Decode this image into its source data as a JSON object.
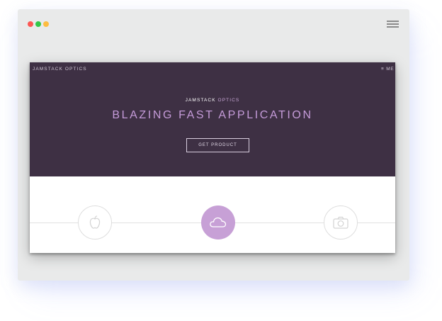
{
  "window": {
    "controls": [
      {
        "name": "close",
        "color": "#fc5753"
      },
      {
        "name": "minimize",
        "color": "#fdbc40"
      },
      {
        "name": "maximize",
        "color": "#33c748"
      }
    ],
    "menu_icon": "hamburger-icon"
  },
  "site": {
    "brand": "JAMSTACK OPTICS",
    "menu_label": "≡ ME"
  },
  "hero": {
    "kicker_main": "JAMSTACK",
    "kicker_sub": "OPTICS",
    "title": "BLAZING FAST APPLICATION",
    "cta_label": "GET PRODUCT"
  },
  "features": [
    {
      "icon": "apple-icon",
      "state": "outline"
    },
    {
      "icon": "cloud-icon",
      "state": "active"
    },
    {
      "icon": "camera-icon",
      "state": "outline"
    }
  ],
  "colors": {
    "hero_bg": "#3e3044",
    "accent": "#c59bd9",
    "active_circle": "#c7a0d6"
  }
}
